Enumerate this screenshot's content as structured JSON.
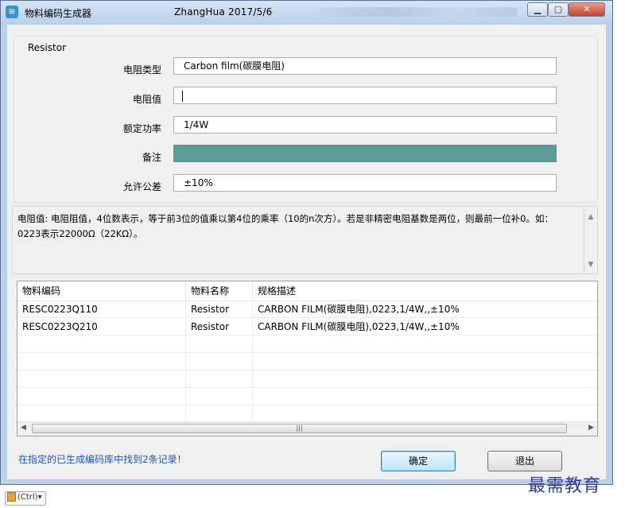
{
  "window": {
    "title": "物料编码生成器",
    "author": "ZhangHua  2017/5/6",
    "icons": {
      "app": "app-icon",
      "minimize": "minimize-icon",
      "maximize": "maximize-icon",
      "close": "close-icon"
    }
  },
  "group": {
    "label": "Resistor",
    "fields": [
      {
        "label": "电阻类型",
        "value": "Carbon film(碳膜电阻)"
      },
      {
        "label": "电阻值",
        "value": ""
      },
      {
        "label": "额定功率",
        "value": "1/4W"
      },
      {
        "label": "备注",
        "value": ""
      },
      {
        "label": "允许公差",
        "value": "±10%"
      }
    ],
    "highlight_color": "#5b9c97"
  },
  "description": "电阻值: 电阻阻值，4位数表示，等于前3位的值乘以第4位的乘率（10的n次方）。若是非精密电阻基数是两位，则最前一位补0。如：0223表示22000Ω（22KΩ）。",
  "table": {
    "columns": [
      "物料编码",
      "物料名称",
      "规格描述"
    ],
    "rows": [
      [
        "RESC0223Q110",
        "Resistor",
        "CARBON FILM(碳膜电阻),0223,1/4W,,±10%"
      ],
      [
        "RESC0223Q210",
        "Resistor",
        "CARBON FILM(碳膜电阻),0223,1/4W,,±10%"
      ]
    ]
  },
  "status": "在指定的已生成编码库中找到2条记录！",
  "buttons": {
    "ok": "确定",
    "exit": "退出"
  },
  "watermark": "最需教育",
  "ctrl_badge": "(Ctrl)▾"
}
